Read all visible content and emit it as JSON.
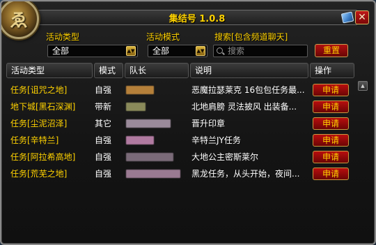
{
  "window": {
    "title": "集结号 1.0.8",
    "close_label": "✕",
    "portrait_glyph": "ゑ"
  },
  "filters": {
    "activity_type_label": "活动类型",
    "activity_type_value": "全部",
    "activity_mode_label": "活动模式",
    "activity_mode_value": "全部",
    "search_label": "搜索[包含频道聊天]",
    "search_placeholder": "搜索",
    "reset_label": "重置"
  },
  "table": {
    "headers": {
      "type": "活动类型",
      "mode": "模式",
      "leader": "队长",
      "desc": "说明",
      "action": "操作"
    },
    "rows": [
      {
        "type": "任务[诅咒之地]",
        "mode": "自强",
        "leader_color": "#b5803a",
        "desc": "恶魔拉瑟莱克 16包包任务最...",
        "apply": "申请"
      },
      {
        "type": "地下城[黑石深渊]",
        "mode": "带新",
        "leader_color": "#8a8a5a",
        "desc": " 北地肩膀 灵法披风 出装备...",
        "apply": "申请"
      },
      {
        "type": "任务[尘泥沼泽]",
        "mode": "其它",
        "leader_color": "#9a8a9a",
        "desc": "晋升印章",
        "apply": "申请"
      },
      {
        "type": "任务[辛特兰]",
        "mode": "自强",
        "leader_color": "#b07aa0",
        "desc": "辛特兰JY任务",
        "apply": "申请"
      },
      {
        "type": "任务[阿拉希高地]",
        "mode": "自强",
        "leader_color": "#7a6a78",
        "desc": "大地公主密斯莱尔",
        "apply": "申请"
      },
      {
        "type": "任务[荒芜之地]",
        "mode": "自强",
        "leader_color": "#9a7a92",
        "desc": "黑龙任务，从头开始，夜间...",
        "apply": "申请"
      }
    ]
  },
  "scrollbar": {
    "up_label": "▲"
  }
}
